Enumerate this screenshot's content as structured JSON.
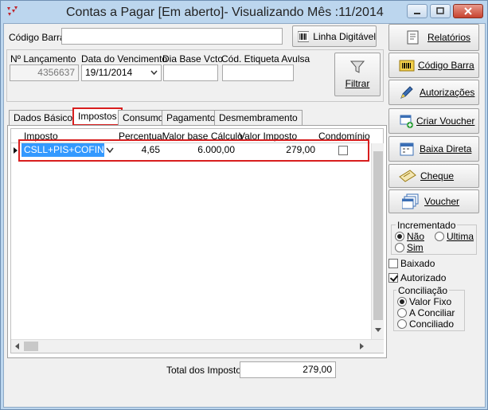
{
  "window": {
    "title": "Contas a Pagar [Em aberto]- Visualizando Mês :11/2014"
  },
  "header": {
    "codigo_barra_label": "Código Barra",
    "codigo_barra_value": "",
    "linha_digitavel_label": "Linha Digitável",
    "lancamento_label": "Nº Lançamento",
    "lancamento_value": "4356637",
    "vencimento_label": "Data do Vencimento",
    "vencimento_value": "19/11/2014",
    "dia_base_label": "Dia Base Vcto",
    "dia_base_value": "",
    "etiqueta_label": "Cód. Etiqueta Avulsa",
    "etiqueta_value": "",
    "filtrar_label": "Filtrar"
  },
  "tabs": [
    {
      "label": "Dados Básicos",
      "active": false
    },
    {
      "label": "Impostos",
      "active": true
    },
    {
      "label": "Consumo",
      "active": false
    },
    {
      "label": "Pagamento",
      "active": false
    },
    {
      "label": "Desmembramento",
      "active": false
    }
  ],
  "grid": {
    "columns": [
      "Imposto",
      "Percentual",
      "Valor base Cálculo",
      "Valor Imposto",
      "Condomínio"
    ],
    "rows": [
      {
        "imposto": "CSLL+PIS+COFINS",
        "percentual": "4,65",
        "valor_base": "6.000,00",
        "valor_imposto": "279,00",
        "condominio": false
      }
    ]
  },
  "footer": {
    "total_label": "Total dos Impostos",
    "total_value": "279,00"
  },
  "side_buttons": [
    {
      "label": "Relatórios"
    },
    {
      "label": "Código Barra"
    },
    {
      "label": "Autorizações"
    },
    {
      "label": "Criar Voucher"
    },
    {
      "label": "Baixa Direta"
    },
    {
      "label": "Cheque"
    },
    {
      "label": "Voucher"
    }
  ],
  "incrementado": {
    "label": "Incrementado",
    "options": [
      {
        "label": "Não",
        "checked": true
      },
      {
        "label": "Ultima",
        "checked": false
      },
      {
        "label": "Sim",
        "checked": false
      }
    ]
  },
  "baixado": {
    "label": "Baixado",
    "checked": false
  },
  "autorizado": {
    "label": "Autorizado",
    "checked": true
  },
  "conciliacao": {
    "label": "Conciliação",
    "options": [
      {
        "label": "Valor Fixo",
        "checked": true
      },
      {
        "label": "A Conciliar",
        "checked": false
      },
      {
        "label": "Conciliado",
        "checked": false
      }
    ]
  },
  "colors": {
    "highlight_red": "#d81e1e",
    "selection_blue": "#3399ff",
    "titlebar_blue": "#bcd6ee"
  }
}
